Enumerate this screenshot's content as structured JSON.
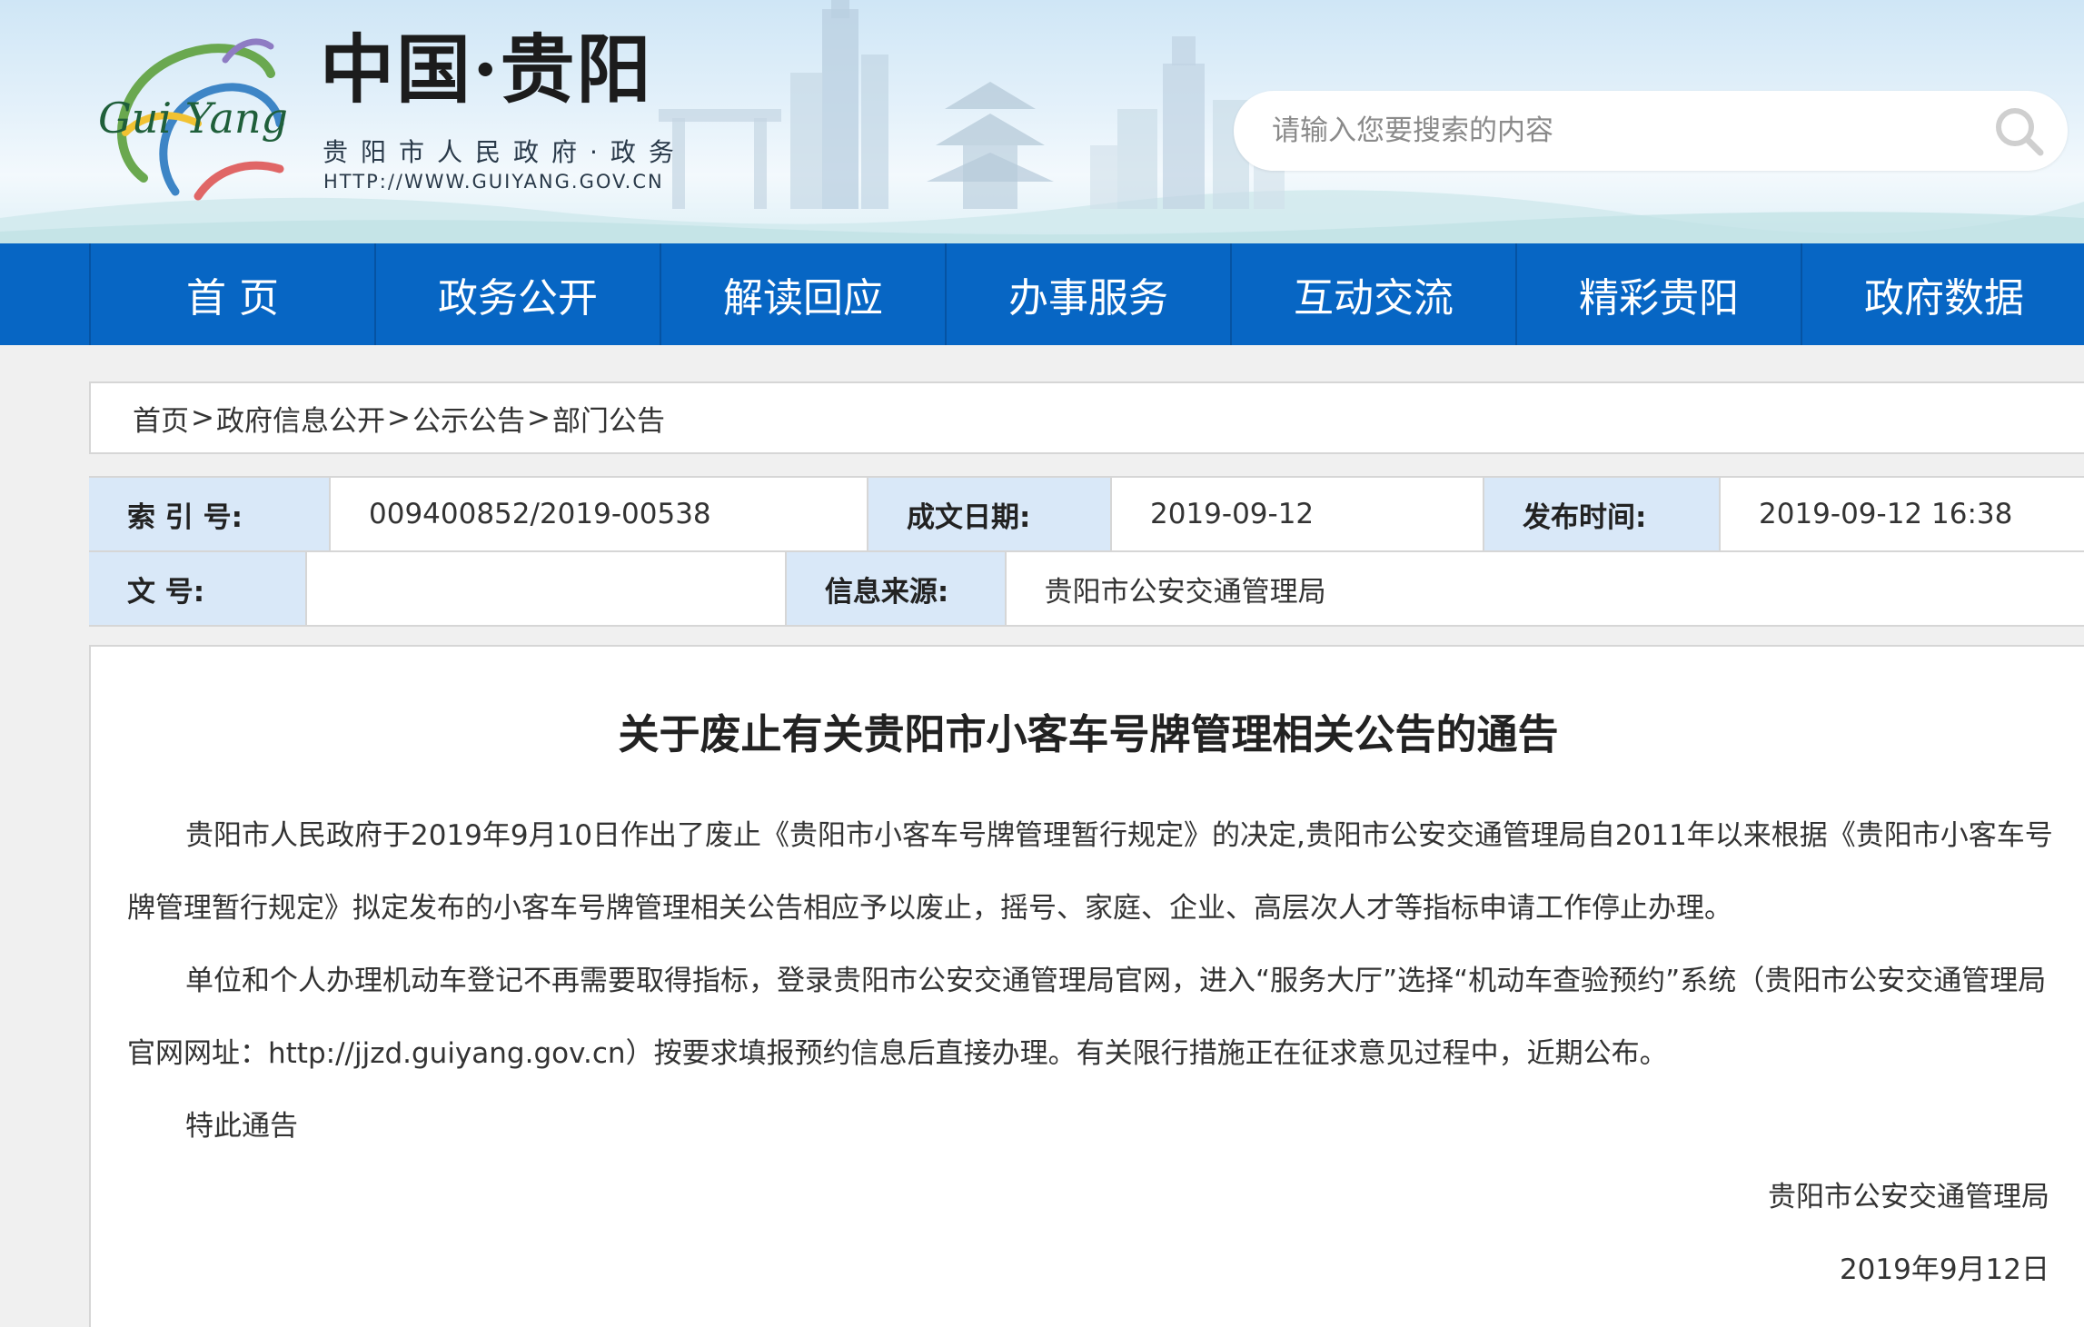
{
  "header": {
    "site_title": "中国·贵阳",
    "site_subtitle": "贵阳市人民政府·政务",
    "site_url": "HTTP://WWW.GUIYANG.GOV.CN",
    "logo_text": "Gui Yang",
    "search": {
      "placeholder": "请输入您要搜索的内容",
      "value": ""
    }
  },
  "nav": {
    "items": [
      {
        "label": "首 页"
      },
      {
        "label": "政务公开"
      },
      {
        "label": "解读回应"
      },
      {
        "label": "办事服务"
      },
      {
        "label": "互动交流"
      },
      {
        "label": "精彩贵阳"
      },
      {
        "label": "政府数据"
      }
    ]
  },
  "breadcrumb": {
    "items": [
      "首页",
      "政府信息公开",
      "公示公告",
      "部门公告"
    ],
    "separator": ">"
  },
  "info": {
    "index_label": "索 引 号:",
    "index_value": "009400852/2019-00538",
    "created_label": "成文日期:",
    "created_value": "2019-09-12",
    "published_label": "发布时间:",
    "published_value": "2019-09-12 16:38",
    "docno_label": "文 号:",
    "docno_value": "",
    "source_label": "信息来源:",
    "source_value": "贵阳市公安交通管理局"
  },
  "article": {
    "title": "关于废止有关贵阳市小客车号牌管理相关公告的通告",
    "paragraphs": [
      "贵阳市人民政府于2019年9月10日作出了废止《贵阳市小客车号牌管理暂行规定》的决定,贵阳市公安交通管理局自2011年以来根据《贵阳市小客车号牌管理暂行规定》拟定发布的小客车号牌管理相关公告相应予以废止，摇号、家庭、企业、高层次人才等指标申请工作停止办理。",
      "单位和个人办理机动车登记不再需要取得指标，登录贵阳市公安交通管理局官网，进入“服务大厅”选择“机动车查验预约”系统（贵阳市公安交通管理局官网网址：http://jjzd.guiyang.gov.cn）按要求填报预约信息后直接办理。有关限行措施正在征求意见过程中，近期公布。",
      "特此通告"
    ],
    "signature_org": "贵阳市公安交通管理局",
    "signature_date": "2019年9月12日"
  },
  "colors": {
    "nav_bg": "#0766c4",
    "label_bg": "#d9e8f8",
    "page_bg": "#f0f0f0"
  },
  "icons": {
    "search": "search-icon",
    "logo": "guiyang-logo"
  }
}
